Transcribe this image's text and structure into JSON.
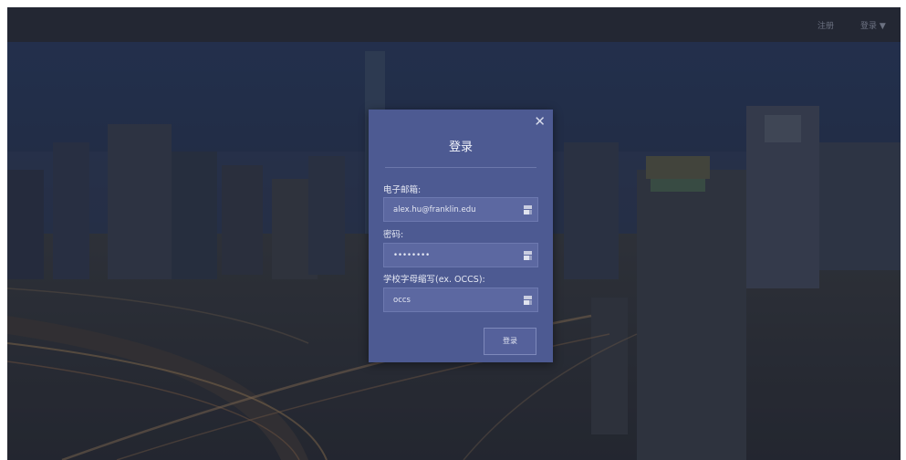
{
  "topbar": {
    "nav_item_1": "注册",
    "nav_item_2": "登录 ▼"
  },
  "modal": {
    "title": "登录",
    "close_glyph": "✕",
    "email": {
      "label": "电子邮箱:",
      "value": "alex.hu@franklin.edu"
    },
    "password": {
      "label": "密码:",
      "value": "••••••••"
    },
    "school": {
      "label": "学校字母缩写(ex. OCCS):",
      "value": "occs"
    },
    "submit_label": "登录"
  },
  "icons": {
    "close": "close-icon",
    "autofill_key": "key-icon"
  },
  "colors": {
    "modal_bg": "#4d5a92",
    "field_bg": "#5c68a1",
    "topbar_bg": "#232733"
  }
}
